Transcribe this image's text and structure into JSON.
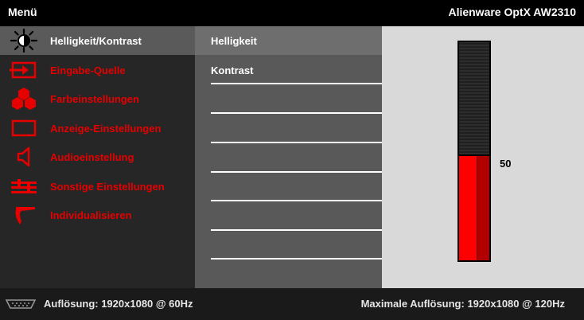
{
  "header": {
    "title": "Menü",
    "model": "Alienware OptX AW2310"
  },
  "sidebar": {
    "items": [
      {
        "label": "Helligkeit/Kontrast",
        "icon": "brightness-icon",
        "active": true
      },
      {
        "label": "Eingabe-Quelle",
        "icon": "input-source-icon",
        "active": false
      },
      {
        "label": "Farbeinstellungen",
        "icon": "color-settings-icon",
        "active": false
      },
      {
        "label": "Anzeige-Einstellungen",
        "icon": "display-settings-icon",
        "active": false
      },
      {
        "label": "Audioeinstellung",
        "icon": "speaker-icon",
        "active": false
      },
      {
        "label": "Sonstige Einstellungen",
        "icon": "other-settings-icon",
        "active": false
      },
      {
        "label": "Individualisieren",
        "icon": "personalize-icon",
        "active": false
      }
    ]
  },
  "submenu": {
    "items": [
      {
        "label": "Helligkeit",
        "selected": true
      },
      {
        "label": "Kontrast",
        "selected": false
      }
    ]
  },
  "slider": {
    "value": "50",
    "fraction": 0.5
  },
  "footer": {
    "resolution": "Auflösung: 1920x1080 @ 60Hz",
    "max_resolution": "Maximale Auflösung: 1920x1080 @ 120Hz"
  },
  "colors": {
    "accent": "#e60000",
    "fill_red": "#ff0000",
    "panel": "#d9d9d9"
  }
}
